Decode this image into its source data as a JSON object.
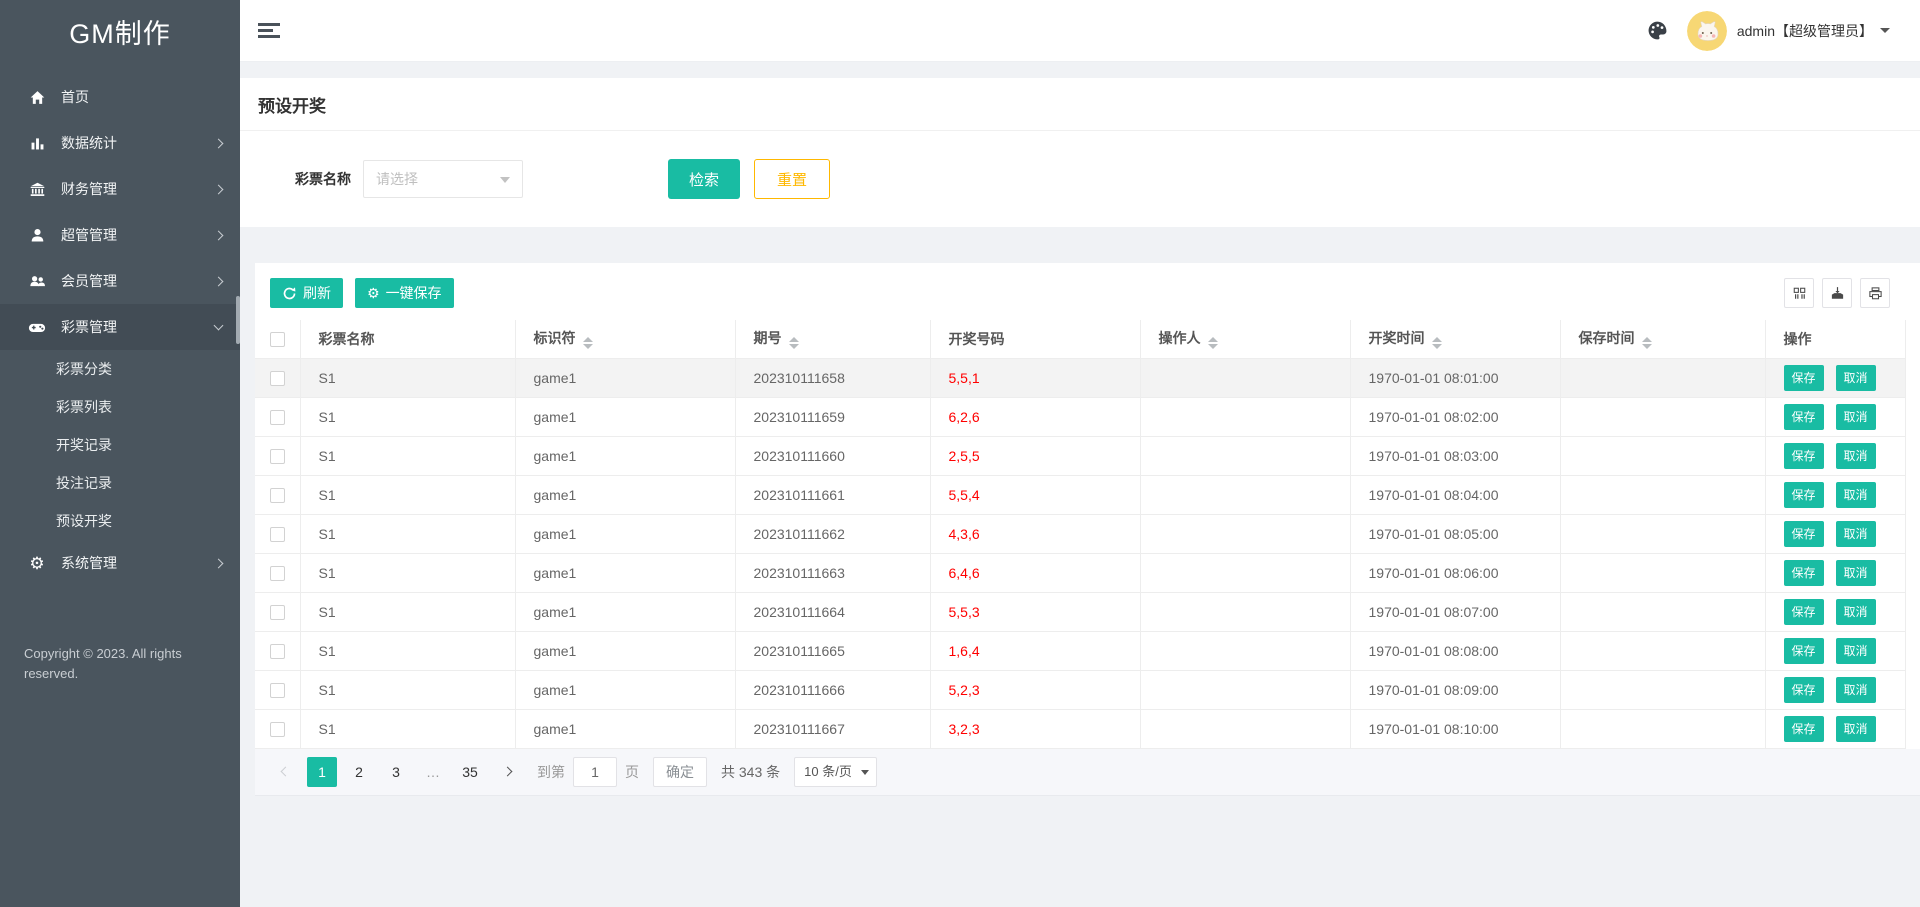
{
  "brand": {
    "logo": "GM制作"
  },
  "sidebar": {
    "items": [
      {
        "label": "首页",
        "icon": "home-icon"
      },
      {
        "label": "数据统计",
        "icon": "bar-chart-icon"
      },
      {
        "label": "财务管理",
        "icon": "bank-icon"
      },
      {
        "label": "超管管理",
        "icon": "user-icon"
      },
      {
        "label": "会员管理",
        "icon": "users-icon"
      },
      {
        "label": "彩票管理",
        "icon": "gamepad-icon",
        "children": [
          "彩票分类",
          "彩票列表",
          "开奖记录",
          "投注记录",
          "预设开奖"
        ]
      },
      {
        "label": "系统管理",
        "icon": "gear-icon"
      }
    ],
    "copyright": "Copyright © 2023. All rights reserved."
  },
  "header": {
    "user": "admin【超级管理员】"
  },
  "page": {
    "title": "预设开奖"
  },
  "filter": {
    "label": "彩票名称",
    "placeholder": "请选择",
    "search_label": "检索",
    "reset_label": "重置"
  },
  "toolbar": {
    "refresh_label": "刷新",
    "save_all_label": "一键保存"
  },
  "table": {
    "columns": [
      {
        "label": "彩票名称",
        "sortable": false
      },
      {
        "label": "标识符",
        "sortable": true
      },
      {
        "label": "期号",
        "sortable": true
      },
      {
        "label": "开奖号码",
        "sortable": false
      },
      {
        "label": "操作人",
        "sortable": true
      },
      {
        "label": "开奖时间",
        "sortable": true
      },
      {
        "label": "保存时间",
        "sortable": true
      },
      {
        "label": "操作",
        "sortable": false
      }
    ],
    "actions": {
      "save": "保存",
      "cancel": "取消"
    },
    "rows": [
      {
        "name": "S1",
        "identifier": "game1",
        "issue": "202310111658",
        "numbers": "5,5,1",
        "operator": "",
        "draw_time": "1970-01-01 08:01:00",
        "save_time": ""
      },
      {
        "name": "S1",
        "identifier": "game1",
        "issue": "202310111659",
        "numbers": "6,2,6",
        "operator": "",
        "draw_time": "1970-01-01 08:02:00",
        "save_time": ""
      },
      {
        "name": "S1",
        "identifier": "game1",
        "issue": "202310111660",
        "numbers": "2,5,5",
        "operator": "",
        "draw_time": "1970-01-01 08:03:00",
        "save_time": ""
      },
      {
        "name": "S1",
        "identifier": "game1",
        "issue": "202310111661",
        "numbers": "5,5,4",
        "operator": "",
        "draw_time": "1970-01-01 08:04:00",
        "save_time": ""
      },
      {
        "name": "S1",
        "identifier": "game1",
        "issue": "202310111662",
        "numbers": "4,3,6",
        "operator": "",
        "draw_time": "1970-01-01 08:05:00",
        "save_time": ""
      },
      {
        "name": "S1",
        "identifier": "game1",
        "issue": "202310111663",
        "numbers": "6,4,6",
        "operator": "",
        "draw_time": "1970-01-01 08:06:00",
        "save_time": ""
      },
      {
        "name": "S1",
        "identifier": "game1",
        "issue": "202310111664",
        "numbers": "5,5,3",
        "operator": "",
        "draw_time": "1970-01-01 08:07:00",
        "save_time": ""
      },
      {
        "name": "S1",
        "identifier": "game1",
        "issue": "202310111665",
        "numbers": "1,6,4",
        "operator": "",
        "draw_time": "1970-01-01 08:08:00",
        "save_time": ""
      },
      {
        "name": "S1",
        "identifier": "game1",
        "issue": "202310111666",
        "numbers": "5,2,3",
        "operator": "",
        "draw_time": "1970-01-01 08:09:00",
        "save_time": ""
      },
      {
        "name": "S1",
        "identifier": "game1",
        "issue": "202310111667",
        "numbers": "3,2,3",
        "operator": "",
        "draw_time": "1970-01-01 08:10:00",
        "save_time": ""
      }
    ]
  },
  "pagination": {
    "pages": [
      "1",
      "2",
      "3",
      "…",
      "35"
    ],
    "active_page": "1",
    "jump_prefix": "到第",
    "jump_value": "1",
    "jump_suffix": "页",
    "confirm_label": "确定",
    "total_label": "共 343 条",
    "page_size_label": "10 条/页"
  },
  "colors": {
    "accent_teal": "#19BCA3",
    "warn_yellow": "#FFB800",
    "number_red": "#FF0000",
    "sidebar_bg": "#4A555E"
  }
}
